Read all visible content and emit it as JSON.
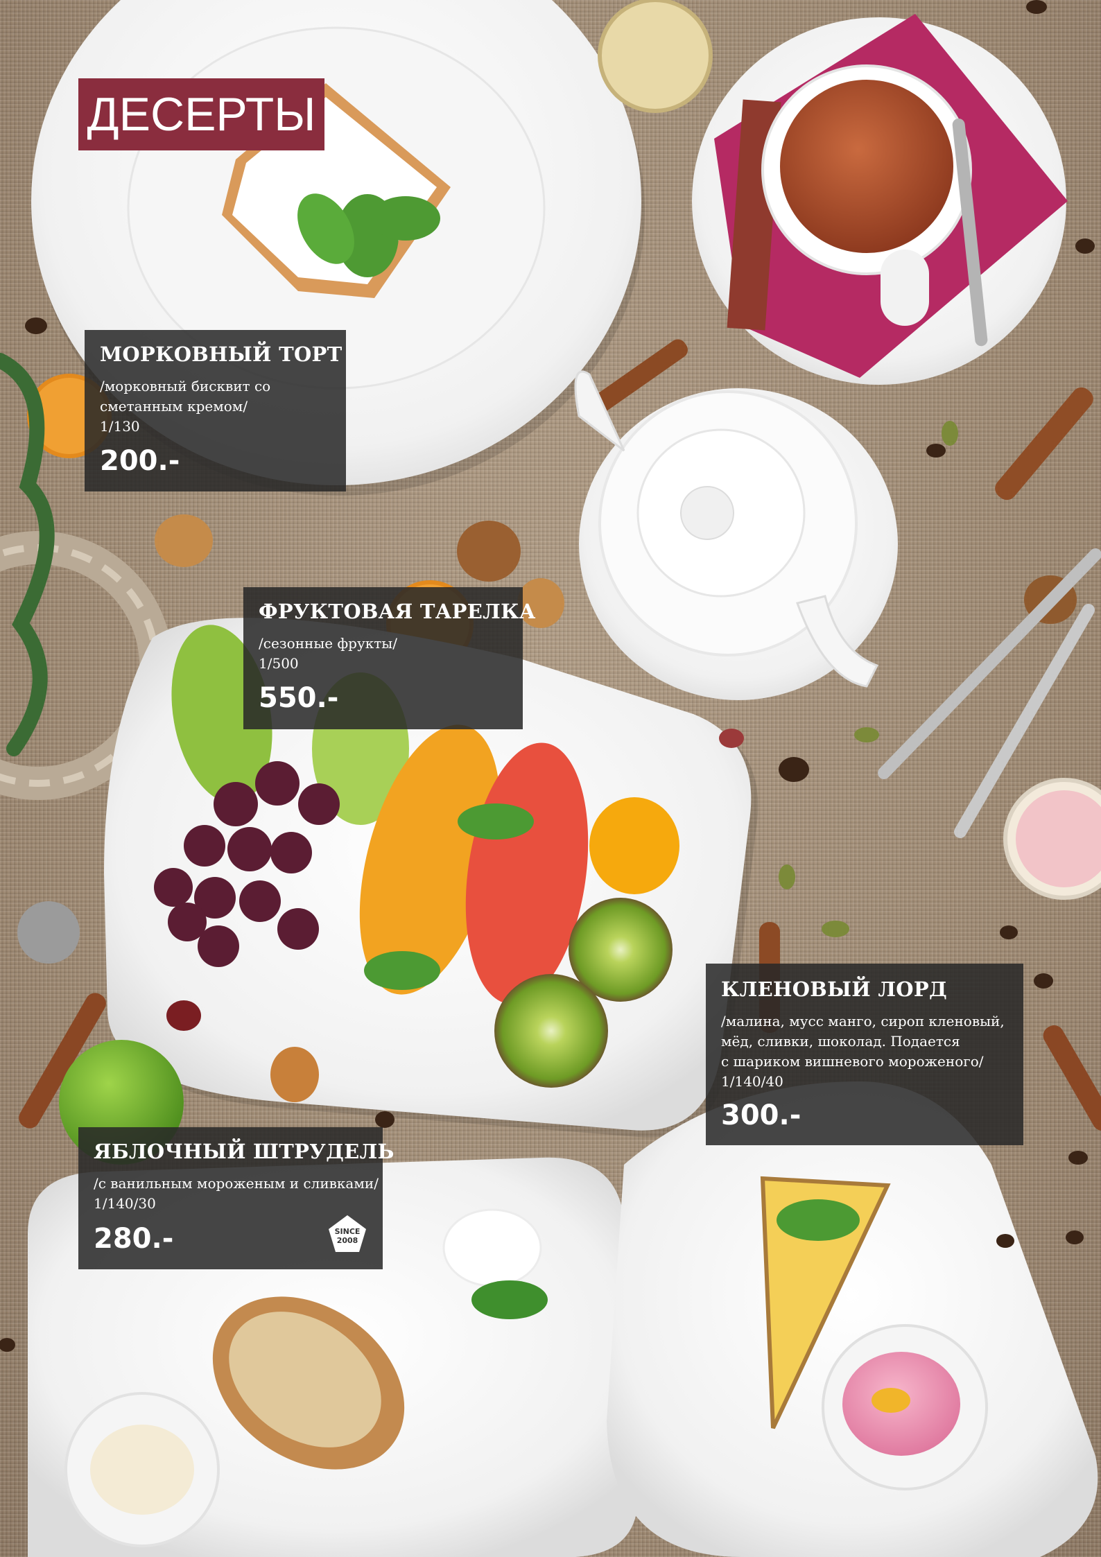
{
  "title": "ДЕСЕРТЫ",
  "items": [
    {
      "name": "МОРКОВНЫЙ ТОРТ",
      "desc": [
        "/морковный бисквит со",
        "сметанным кремом/",
        "1/130"
      ],
      "price": "200.-"
    },
    {
      "name": "ФРУКТОВАЯ ТАРЕЛКА",
      "desc": [
        "/сезонные фрукты/",
        "1/500"
      ],
      "price": "550.-"
    },
    {
      "name": "КЛЕНОВЫЙ ЛОРД",
      "desc": [
        "/малина, мусс манго, сироп кленовый,",
        "мёд, сливки, шоколад. Подается",
        "с шариком вишневого мороженого/",
        "1/140/40"
      ],
      "price": "300.-"
    },
    {
      "name": "ЯБЛОЧНЫЙ ШТРУДЕЛЬ",
      "desc": [
        "/с ванильным мороженым и сливками/",
        "1/140/30"
      ],
      "price": "280.-"
    }
  ],
  "badge": {
    "line1": "SINCE",
    "line2": "2008"
  },
  "colors": {
    "title_bg": "#8a2d3e",
    "panel_bg": "#282828"
  }
}
